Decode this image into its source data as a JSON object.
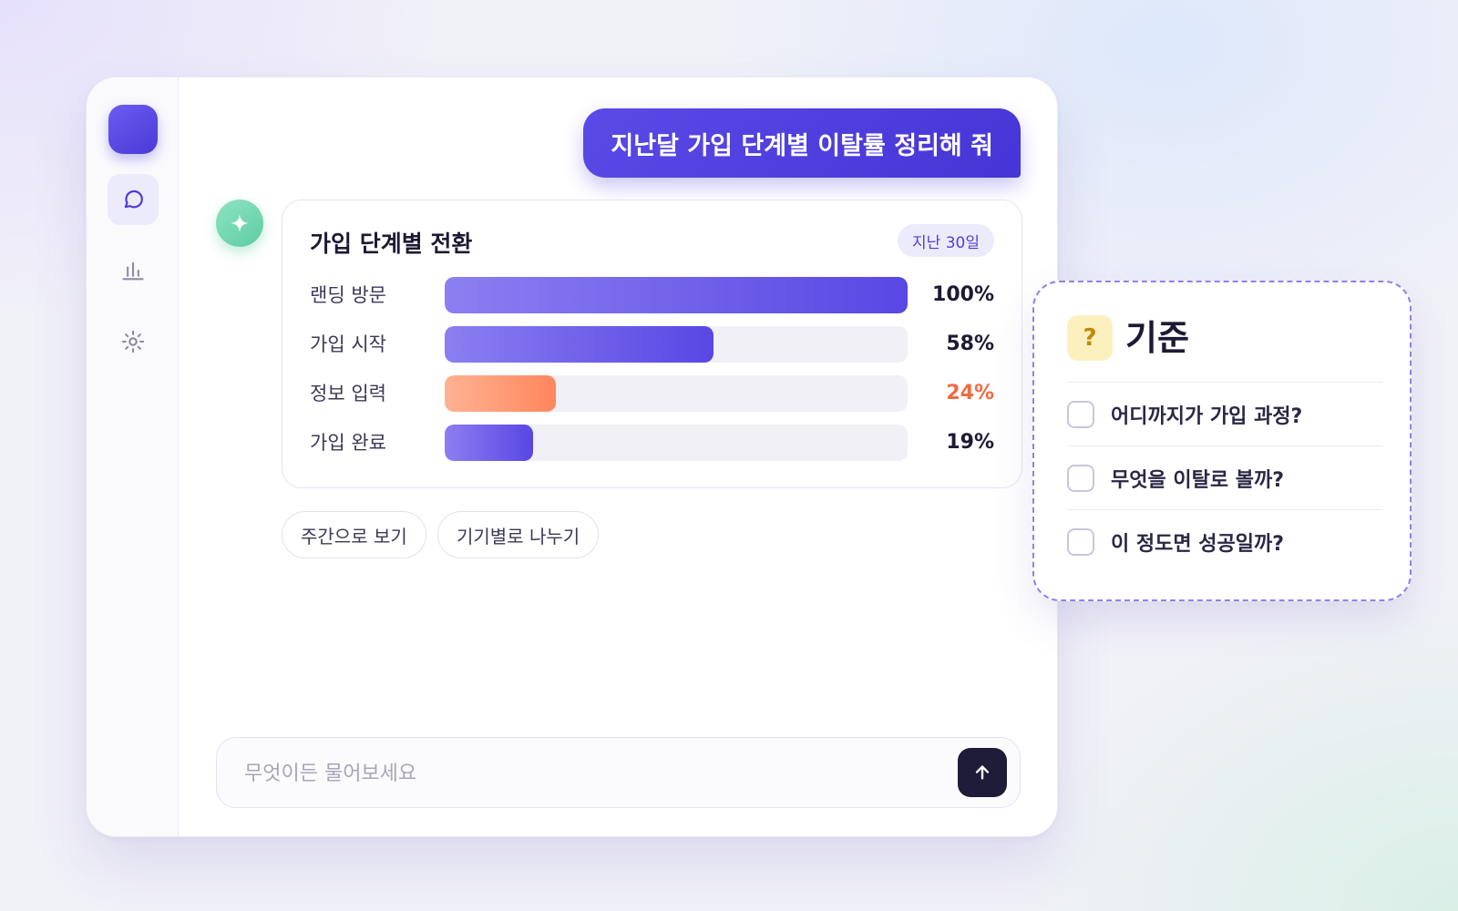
{
  "user_message": "지난달 가입 단계별 이탈률 정리해 줘",
  "chart_card": {
    "title": "가입 단계별 전환",
    "period": "지난 30일"
  },
  "chart_data": {
    "type": "bar",
    "orientation": "horizontal",
    "title": "가입 단계별 전환",
    "categories": [
      "랜딩 방문",
      "가입 시작",
      "정보 입력",
      "가입 완료"
    ],
    "values": [
      100,
      58,
      24,
      19
    ],
    "value_labels": [
      "100%",
      "58%",
      "24%",
      "19%"
    ],
    "highlight_index": 2,
    "xlim": [
      0,
      100
    ],
    "colors": {
      "bar": "#5847e4",
      "highlight": "#ff865c",
      "highlight_text": "#f06a40"
    }
  },
  "suggestions": [
    "주간으로 보기",
    "기기별로 나누기"
  ],
  "composer": {
    "placeholder": "무엇이든 물어보세요"
  },
  "criteria": {
    "icon_text": "?",
    "title": "기준",
    "items": [
      {
        "label": "어디까지가 가입 과정?",
        "checked": false
      },
      {
        "label": "무엇을 이탈로 볼까?",
        "checked": false
      },
      {
        "label": "이 정도면 성공일까?",
        "checked": false
      }
    ]
  },
  "sidebar": {
    "items": [
      {
        "icon": "chat-icon",
        "active": true
      },
      {
        "icon": "bar-chart-icon",
        "active": false
      },
      {
        "icon": "settings-icon",
        "active": false
      }
    ]
  },
  "theme": {
    "accent": "#4b3ad8",
    "ai_avatar": "#5ccda3"
  }
}
